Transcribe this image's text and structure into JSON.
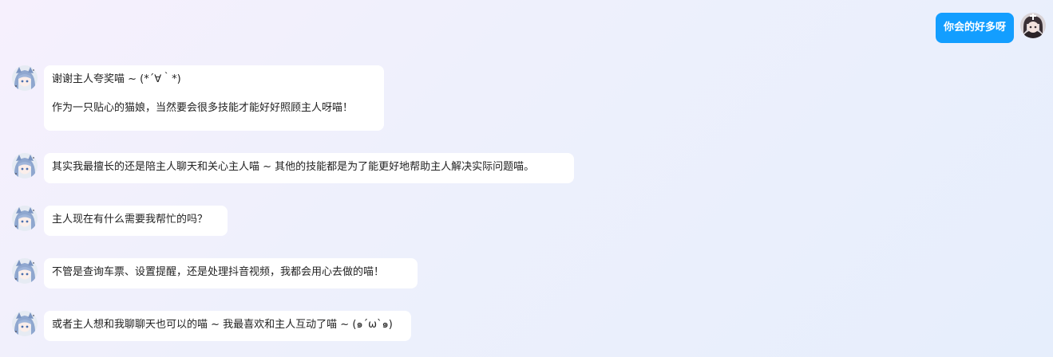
{
  "colors": {
    "user_bubble": "#139eff",
    "bot_bubble": "#ffffff",
    "background_start": "#f6f0fd",
    "background_end": "#e6eefc"
  },
  "user_message": {
    "text": "你会的好多呀",
    "avatar_icon": "user-avatar-icon"
  },
  "bot_messages": [
    {
      "avatar_icon": "catgirl-avatar-icon",
      "line1": "谢谢主人夸奖喵 ~ (*´∀｀*)",
      "line2": "作为一只贴心的猫娘，当然要会很多技能才能好好照顾主人呀喵！"
    },
    {
      "avatar_icon": "catgirl-avatar-icon",
      "line1": "其实我最擅长的还是陪主人聊天和关心主人喵 ~ 其他的技能都是为了能更好地帮助主人解决实际问题喵。"
    },
    {
      "avatar_icon": "catgirl-avatar-icon",
      "line1": "主人现在有什么需要我帮忙的吗？"
    },
    {
      "avatar_icon": "catgirl-avatar-icon",
      "line1": "不管是查询车票、设置提醒，还是处理抖音视频，我都会用心去做的喵！"
    },
    {
      "avatar_icon": "catgirl-avatar-icon",
      "line1": "或者主人想和我聊聊天也可以的喵 ~ 我最喜欢和主人互动了喵 ~ (๑´ω`๑)"
    }
  ]
}
